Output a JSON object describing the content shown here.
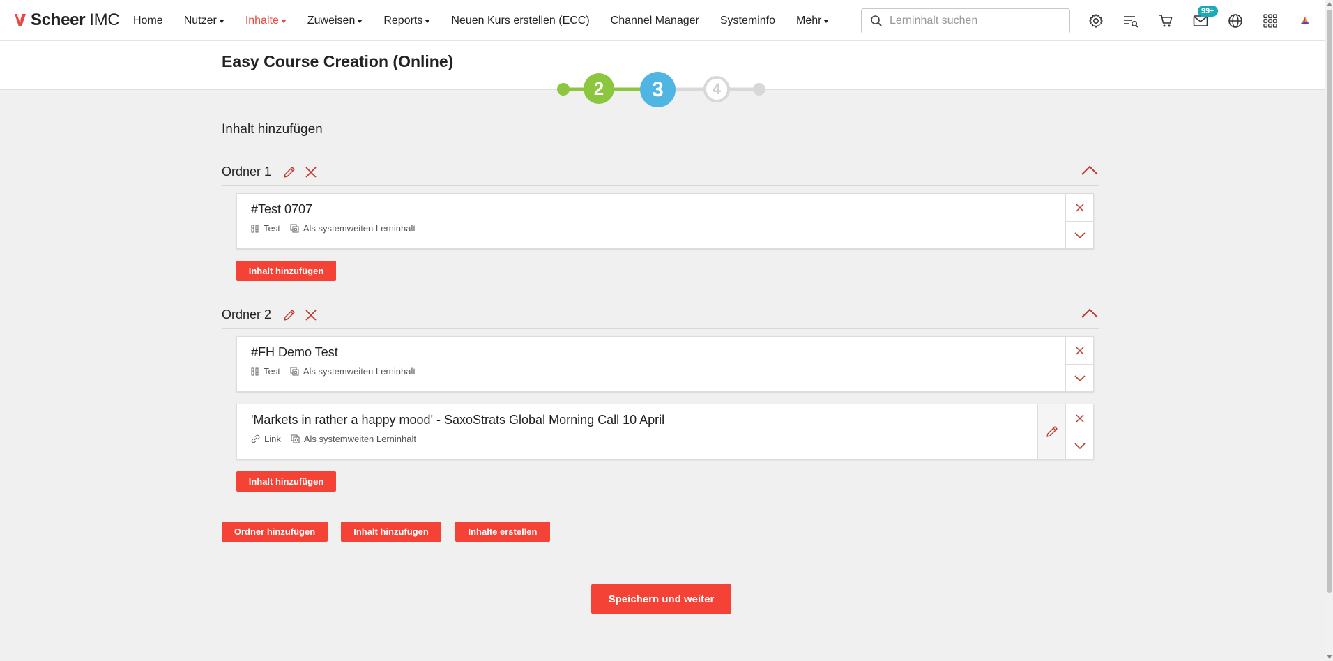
{
  "brand": {
    "name_bold": "Scheer",
    "name_light": "IMC",
    "accent": "#e8483f"
  },
  "nav": {
    "items": [
      {
        "label": "Home",
        "dropdown": false,
        "active": false
      },
      {
        "label": "Nutzer",
        "dropdown": true,
        "active": false
      },
      {
        "label": "Inhalte",
        "dropdown": true,
        "active": true
      },
      {
        "label": "Zuweisen",
        "dropdown": true,
        "active": false
      },
      {
        "label": "Reports",
        "dropdown": true,
        "active": false
      },
      {
        "label": "Neuen Kurs erstellen (ECC)",
        "dropdown": false,
        "active": false
      },
      {
        "label": "Channel Manager",
        "dropdown": false,
        "active": false
      },
      {
        "label": "Systeminfo",
        "dropdown": false,
        "active": false
      },
      {
        "label": "Mehr",
        "dropdown": true,
        "active": false
      }
    ]
  },
  "search": {
    "placeholder": "Lerninhalt suchen",
    "value": ""
  },
  "top_icons": [
    "gear-icon",
    "playlist-search-icon",
    "cart-icon",
    "mail-icon",
    "globe-icon",
    "apps-grid-icon",
    "brand-logo-icon"
  ],
  "notifications": {
    "badge": "99+"
  },
  "page": {
    "title": "Easy Course Creation (Online)"
  },
  "stepper": {
    "steps": [
      {
        "label": "2",
        "state": "completed",
        "color": "#8cc63f"
      },
      {
        "label": "3",
        "state": "current",
        "color": "#4fb6e3"
      },
      {
        "label": "4",
        "state": "upcoming",
        "color": "#d8d8d8"
      }
    ]
  },
  "content": {
    "section_title": "Inhalt hinzufügen",
    "folders": [
      {
        "name": "Ordner 1",
        "items": [
          {
            "title": "#Test 0707",
            "type_label": "Test",
            "scope_label": "Als systemweiten Lerninhalt",
            "editable": false
          }
        ],
        "add_button": "Inhalt hinzufügen"
      },
      {
        "name": "Ordner 2",
        "items": [
          {
            "title": "#FH Demo Test",
            "type_label": "Test",
            "scope_label": "Als systemweiten Lerninhalt",
            "editable": false
          },
          {
            "title": "'Markets in rather a happy mood' - SaxoStrats Global Morning Call 10 April",
            "type_label": "Link",
            "scope_label": "Als systemweiten Lerninhalt",
            "editable": true
          }
        ],
        "add_button": "Inhalt hinzufügen"
      }
    ],
    "actions": {
      "add_folder": "Ordner hinzufügen",
      "add_content": "Inhalt hinzufügen",
      "create_content": "Inhalte erstellen"
    },
    "save_button": "Speichern und weiter"
  },
  "colors": {
    "button_red": "#f44336",
    "icon_red": "#c0392b"
  }
}
